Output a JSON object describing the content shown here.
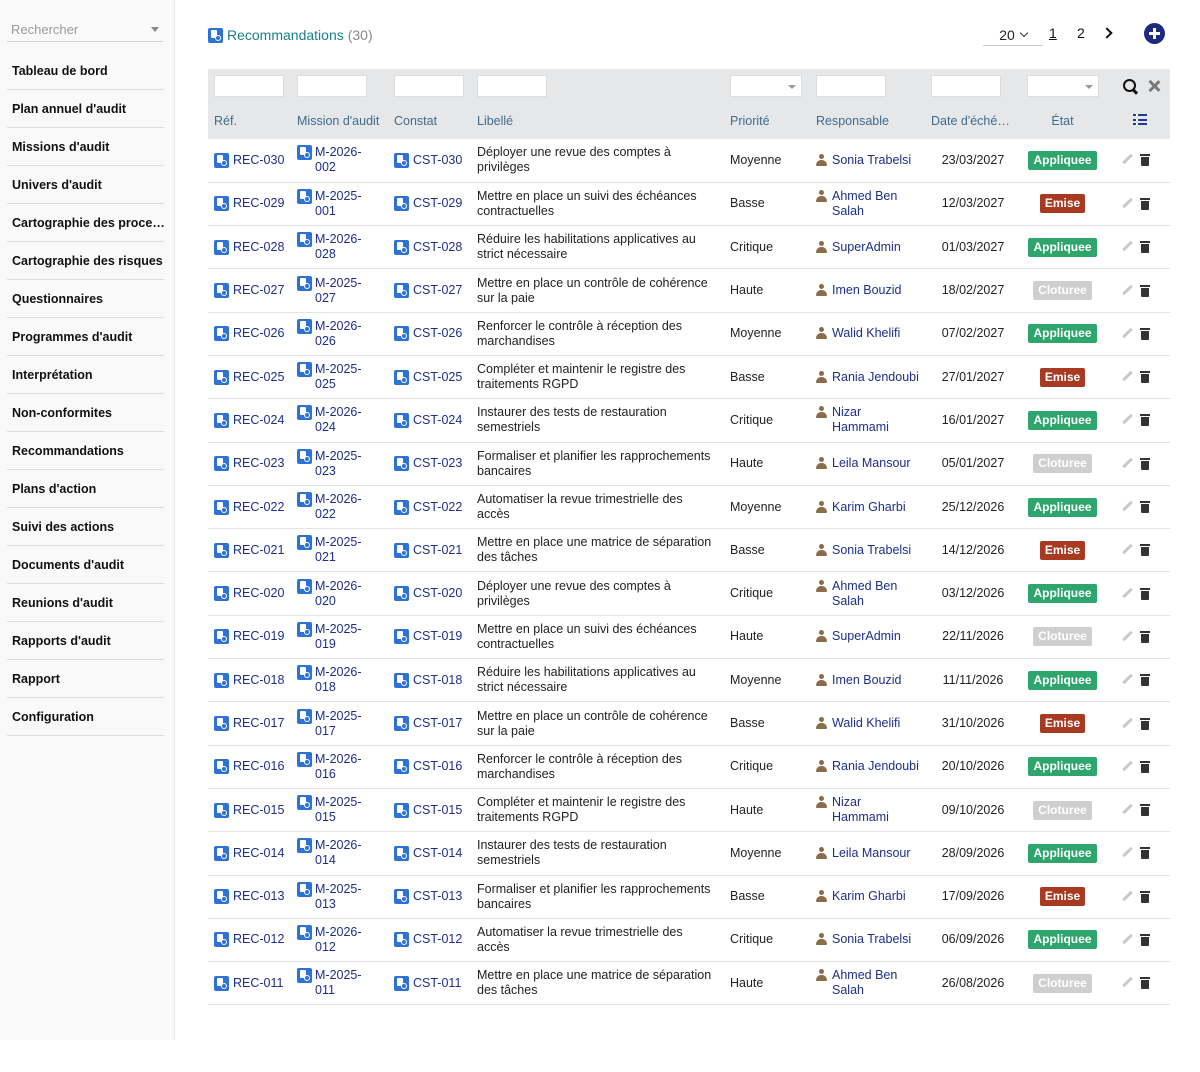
{
  "colors": {
    "appliquee": "#2da56d",
    "emise": "#a83a22",
    "cloturee": "#cfcfcf",
    "link": "#1c2f8a",
    "title": "#1a7f8a",
    "header_bg": "#e6e7e9"
  },
  "sidebar": {
    "search_placeholder": "Rechercher",
    "items": [
      {
        "label": "Tableau de bord"
      },
      {
        "label": "Plan annuel d'audit"
      },
      {
        "label": "Missions d'audit"
      },
      {
        "label": "Univers d'audit"
      },
      {
        "label": "Cartographie des proce…"
      },
      {
        "label": "Cartographie des risques"
      },
      {
        "label": "Questionnaires"
      },
      {
        "label": "Programmes d'audit"
      },
      {
        "label": "Interprétation"
      },
      {
        "label": "Non-conformites"
      },
      {
        "label": "Recommandations"
      },
      {
        "label": "Plans d'action"
      },
      {
        "label": "Suivi des actions"
      },
      {
        "label": "Documents d'audit"
      },
      {
        "label": "Reunions d'audit"
      },
      {
        "label": "Rapports d'audit"
      },
      {
        "label": "Rapport"
      },
      {
        "label": "Configuration"
      }
    ]
  },
  "header": {
    "title": "Recommandations",
    "count": "(30)",
    "page_size": "20",
    "pages": [
      "1",
      "2"
    ],
    "current_page": "1"
  },
  "table": {
    "columns": [
      "Réf.",
      "Mission d'audit",
      "Constat",
      "Libellé",
      "Priorité",
      "Responsable",
      "Date d'éché…",
      "État"
    ],
    "rows": [
      {
        "ref": "REC-030",
        "m1": "M-2026-",
        "m2": "002",
        "constat": "CST-030",
        "libelle": "Déployer une revue des comptes à privilèges",
        "priorite": "Moyenne",
        "resp1": "Sonia Trabelsi",
        "resp2": "",
        "date": "23/03/2027",
        "etat": "Appliquee"
      },
      {
        "ref": "REC-029",
        "m1": "M-2025-",
        "m2": "001",
        "constat": "CST-029",
        "libelle": "Mettre en place un suivi des échéances contractuelles",
        "priorite": "Basse",
        "resp1": "Ahmed Ben",
        "resp2": "Salah",
        "date": "12/03/2027",
        "etat": "Emise"
      },
      {
        "ref": "REC-028",
        "m1": "M-2026-",
        "m2": "028",
        "constat": "CST-028",
        "libelle": "Réduire les habilitations applicatives au strict nécessaire",
        "priorite": "Critique",
        "resp1": "SuperAdmin",
        "resp2": "",
        "date": "01/03/2027",
        "etat": "Appliquee"
      },
      {
        "ref": "REC-027",
        "m1": "M-2025-",
        "m2": "027",
        "constat": "CST-027",
        "libelle": "Mettre en place un contrôle de cohérence sur la paie",
        "priorite": "Haute",
        "resp1": "Imen Bouzid",
        "resp2": "",
        "date": "18/02/2027",
        "etat": "Cloturee"
      },
      {
        "ref": "REC-026",
        "m1": "M-2026-",
        "m2": "026",
        "constat": "CST-026",
        "libelle": "Renforcer le contrôle à réception des marchandises",
        "priorite": "Moyenne",
        "resp1": "Walid Khelifi",
        "resp2": "",
        "date": "07/02/2027",
        "etat": "Appliquee"
      },
      {
        "ref": "REC-025",
        "m1": "M-2025-",
        "m2": "025",
        "constat": "CST-025",
        "libelle": "Compléter et maintenir le registre des traitements RGPD",
        "priorite": "Basse",
        "resp1": "Rania Jendoubi",
        "resp2": "",
        "date": "27/01/2027",
        "etat": "Emise"
      },
      {
        "ref": "REC-024",
        "m1": "M-2026-",
        "m2": "024",
        "constat": "CST-024",
        "libelle": "Instaurer des tests de restauration semestriels",
        "priorite": "Critique",
        "resp1": "Nizar",
        "resp2": "Hammami",
        "date": "16/01/2027",
        "etat": "Appliquee"
      },
      {
        "ref": "REC-023",
        "m1": "M-2025-",
        "m2": "023",
        "constat": "CST-023",
        "libelle": "Formaliser et planifier les rapprochements bancaires",
        "priorite": "Haute",
        "resp1": "Leila Mansour",
        "resp2": "",
        "date": "05/01/2027",
        "etat": "Cloturee"
      },
      {
        "ref": "REC-022",
        "m1": "M-2026-",
        "m2": "022",
        "constat": "CST-022",
        "libelle": "Automatiser la revue trimestrielle des accès",
        "priorite": "Moyenne",
        "resp1": "Karim Gharbi",
        "resp2": "",
        "date": "25/12/2026",
        "etat": "Appliquee"
      },
      {
        "ref": "REC-021",
        "m1": "M-2025-",
        "m2": "021",
        "constat": "CST-021",
        "libelle": "Mettre en place une matrice de séparation des tâches",
        "priorite": "Basse",
        "resp1": "Sonia Trabelsi",
        "resp2": "",
        "date": "14/12/2026",
        "etat": "Emise"
      },
      {
        "ref": "REC-020",
        "m1": "M-2026-",
        "m2": "020",
        "constat": "CST-020",
        "libelle": "Déployer une revue des comptes à privilèges",
        "priorite": "Critique",
        "resp1": "Ahmed Ben",
        "resp2": "Salah",
        "date": "03/12/2026",
        "etat": "Appliquee"
      },
      {
        "ref": "REC-019",
        "m1": "M-2025-",
        "m2": "019",
        "constat": "CST-019",
        "libelle": "Mettre en place un suivi des échéances contractuelles",
        "priorite": "Haute",
        "resp1": "SuperAdmin",
        "resp2": "",
        "date": "22/11/2026",
        "etat": "Cloturee"
      },
      {
        "ref": "REC-018",
        "m1": "M-2026-",
        "m2": "018",
        "constat": "CST-018",
        "libelle": "Réduire les habilitations applicatives au strict nécessaire",
        "priorite": "Moyenne",
        "resp1": "Imen Bouzid",
        "resp2": "",
        "date": "11/11/2026",
        "etat": "Appliquee"
      },
      {
        "ref": "REC-017",
        "m1": "M-2025-",
        "m2": "017",
        "constat": "CST-017",
        "libelle": "Mettre en place un contrôle de cohérence sur la paie",
        "priorite": "Basse",
        "resp1": "Walid Khelifi",
        "resp2": "",
        "date": "31/10/2026",
        "etat": "Emise"
      },
      {
        "ref": "REC-016",
        "m1": "M-2026-",
        "m2": "016",
        "constat": "CST-016",
        "libelle": "Renforcer le contrôle à réception des marchandises",
        "priorite": "Critique",
        "resp1": "Rania Jendoubi",
        "resp2": "",
        "date": "20/10/2026",
        "etat": "Appliquee"
      },
      {
        "ref": "REC-015",
        "m1": "M-2025-",
        "m2": "015",
        "constat": "CST-015",
        "libelle": "Compléter et maintenir le registre des traitements RGPD",
        "priorite": "Haute",
        "resp1": "Nizar",
        "resp2": "Hammami",
        "date": "09/10/2026",
        "etat": "Cloturee"
      },
      {
        "ref": "REC-014",
        "m1": "M-2026-",
        "m2": "014",
        "constat": "CST-014",
        "libelle": "Instaurer des tests de restauration semestriels",
        "priorite": "Moyenne",
        "resp1": "Leila Mansour",
        "resp2": "",
        "date": "28/09/2026",
        "etat": "Appliquee"
      },
      {
        "ref": "REC-013",
        "m1": "M-2025-",
        "m2": "013",
        "constat": "CST-013",
        "libelle": "Formaliser et planifier les rapprochements bancaires",
        "priorite": "Basse",
        "resp1": "Karim Gharbi",
        "resp2": "",
        "date": "17/09/2026",
        "etat": "Emise"
      },
      {
        "ref": "REC-012",
        "m1": "M-2026-",
        "m2": "012",
        "constat": "CST-012",
        "libelle": "Automatiser la revue trimestrielle des accès",
        "priorite": "Critique",
        "resp1": "Sonia Trabelsi",
        "resp2": "",
        "date": "06/09/2026",
        "etat": "Appliquee"
      },
      {
        "ref": "REC-011",
        "m1": "M-2025-",
        "m2": "011",
        "constat": "CST-011",
        "libelle": "Mettre en place une matrice de séparation des tâches",
        "priorite": "Haute",
        "resp1": "Ahmed Ben",
        "resp2": "Salah",
        "date": "26/08/2026",
        "etat": "Cloturee"
      }
    ]
  }
}
